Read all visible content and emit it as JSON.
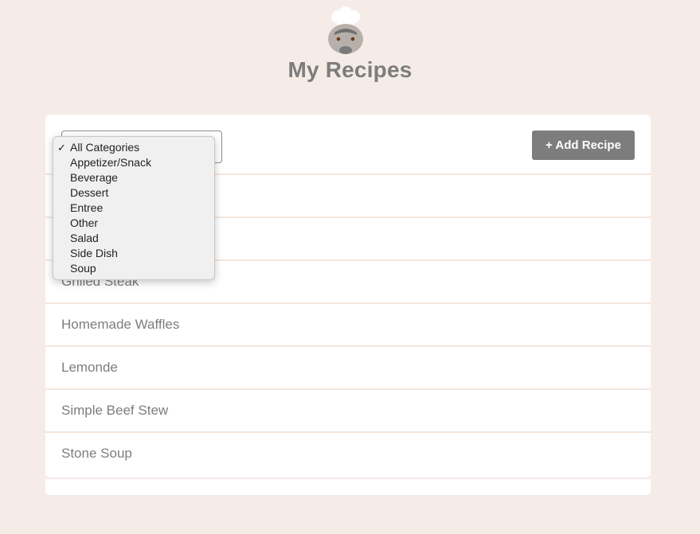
{
  "header": {
    "title": "My Recipes",
    "logo_icon": "chef-icon"
  },
  "toolbar": {
    "category_select": {
      "selected": "All Categories",
      "options": [
        "All Categories",
        "Appetizer/Snack",
        "Beverage",
        "Dessert",
        "Entree",
        "Other",
        "Salad",
        "Side Dish",
        "Soup"
      ]
    },
    "add_button_label": "+ Add Recipe"
  },
  "recipes": [
    "",
    "",
    "Grilled Steak",
    "Homemade Waffles",
    "Lemonde",
    "Simple Beef Stew",
    "Stone Soup"
  ],
  "colors": {
    "background": "#f5ebe7",
    "accent": "#7d7d7d",
    "card": "#ffffff"
  }
}
